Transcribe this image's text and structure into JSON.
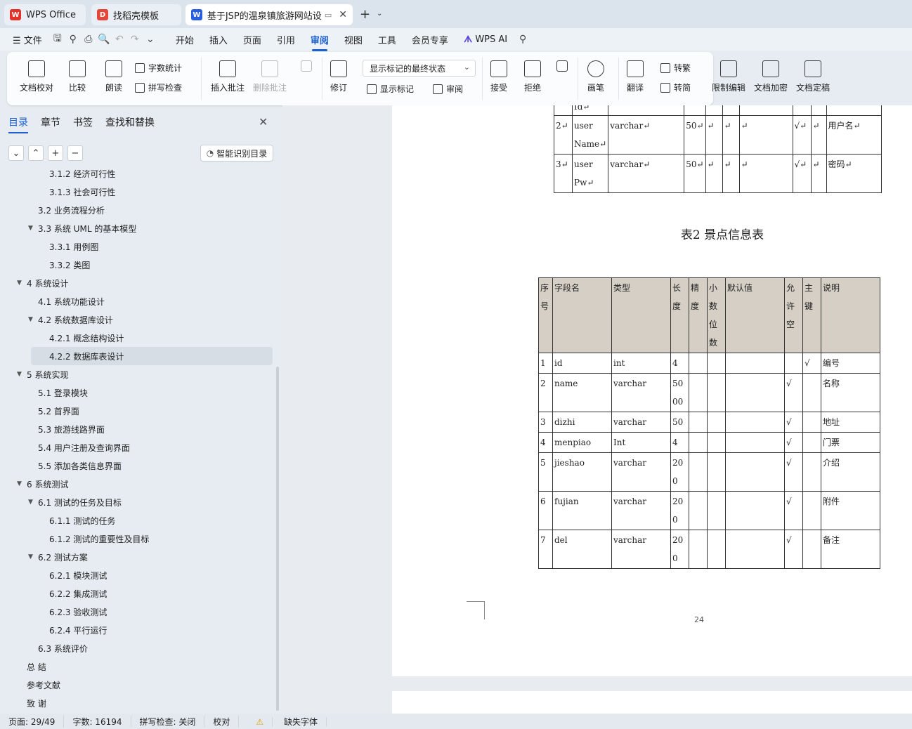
{
  "tabs": [
    {
      "label": "WPS Office"
    },
    {
      "label": "找稻壳模板"
    },
    {
      "label": "基于JSP的温泉镇旅游网站设计"
    }
  ],
  "menu": {
    "file": "文件",
    "items": [
      "开始",
      "插入",
      "页面",
      "引用",
      "审阅",
      "视图",
      "工具",
      "会员专享"
    ],
    "active": "审阅",
    "wps_ai": "WPS AI"
  },
  "ribbon": {
    "doc_check": "文档校对",
    "compare": "比较",
    "read": "朗读",
    "word_count": "字数统计",
    "spell_check": "拼写检查",
    "insert_comment": "插入批注",
    "delete_comment": "删除批注",
    "revise": "修订",
    "markup_dropdown": "显示标记的最终状态",
    "show_markup": "显示标记",
    "review": "审阅",
    "accept": "接受",
    "reject": "拒绝",
    "pen": "画笔",
    "translate": "翻译",
    "to_traditional": "转繁",
    "to_simplified": "转简",
    "restrict_edit": "限制编辑",
    "encrypt": "文档加密",
    "finalize": "文档定稿"
  },
  "sidebar": {
    "tabs": [
      "目录",
      "章节",
      "书签",
      "查找和替换"
    ],
    "smart_toc": "智能识别目录",
    "toc": [
      {
        "label": "3.1.2  经济可行性",
        "level": 3
      },
      {
        "label": "3.1.3  社会可行性",
        "level": 3
      },
      {
        "label": "3.2  业务流程分析",
        "level": 2
      },
      {
        "label": "3.3  系统 UML 的基本模型",
        "level": 2,
        "toggle": "▼"
      },
      {
        "label": "3.3.1  用例图",
        "level": 3
      },
      {
        "label": "3.3.2  类图",
        "level": 3
      },
      {
        "label": "4  系统设计",
        "level": 1,
        "toggle": "▼"
      },
      {
        "label": "4.1  系统功能设计",
        "level": 2
      },
      {
        "label": "4.2  系统数据库设计",
        "level": 2,
        "toggle": "▼"
      },
      {
        "label": "4.2.1  概念结构设计",
        "level": 3
      },
      {
        "label": "4.2.2  数据库表设计",
        "level": 3,
        "selected": true
      },
      {
        "label": "5  系统实现",
        "level": 1,
        "toggle": "▼"
      },
      {
        "label": "5.1 登录模块",
        "level": 2
      },
      {
        "label": "5.2  首界面",
        "level": 2
      },
      {
        "label": "5.3  旅游线路界面",
        "level": 2
      },
      {
        "label": "5.4  用户注册及查询界面",
        "level": 2
      },
      {
        "label": "5.5  添加各类信息界面",
        "level": 2
      },
      {
        "label": "6  系统测试",
        "level": 1,
        "toggle": "▼"
      },
      {
        "label": "6.1 测试的任务及目标",
        "level": 2,
        "toggle": "▼"
      },
      {
        "label": "6.1.1 测试的任务",
        "level": 3
      },
      {
        "label": "6.1.2 测试的重要性及目标",
        "level": 3
      },
      {
        "label": "6.2 测试方案",
        "level": 2,
        "toggle": "▼"
      },
      {
        "label": "6.2.1 模块测试",
        "level": 3
      },
      {
        "label": "6.2.2 集成测试",
        "level": 3
      },
      {
        "label": "6.2.3 验收测试",
        "level": 3
      },
      {
        "label": "6.2.4 平行运行",
        "level": 3
      },
      {
        "label": "6.3 系统评价",
        "level": 2
      },
      {
        "label": "总    结",
        "level": 1
      },
      {
        "label": "参考文献",
        "level": 1
      },
      {
        "label": "致    谢",
        "level": 1
      }
    ]
  },
  "document": {
    "table1_rows": [
      [
        "",
        "Id↵",
        "",
        "",
        "",
        "",
        "",
        "",
        "",
        ""
      ],
      [
        "2↵",
        "user Name↵",
        "varchar↵",
        "50↵",
        "↵",
        "↵",
        "↵",
        "√↵",
        "↵",
        "用户名↵"
      ],
      [
        "3↵",
        "user Pw↵",
        "varchar↵",
        "50↵",
        "↵",
        "↵",
        "↵",
        "√↵",
        "↵",
        "密码↵"
      ]
    ],
    "caption": "表2  景点信息表",
    "table2_header": [
      "序号",
      "字段名",
      "类型",
      "长度",
      "精度",
      "小数位数",
      "默认值",
      "允许空",
      "主键",
      "说明"
    ],
    "table2_rows": [
      [
        "1",
        "id",
        "int",
        "4",
        "",
        "",
        "",
        "",
        "√",
        "编号"
      ],
      [
        "2",
        "name",
        "varchar",
        "5000",
        "",
        "",
        "",
        "√",
        "",
        "名称"
      ],
      [
        "3",
        "dizhi",
        "varchar",
        "50",
        "",
        "",
        "",
        "√",
        "",
        "地址"
      ],
      [
        "4",
        "menpiao",
        "Int",
        "4",
        "",
        "",
        "",
        "√",
        "",
        "门票"
      ],
      [
        "5",
        "jieshao",
        "varchar",
        "200",
        "",
        "",
        "",
        "√",
        "",
        "介绍"
      ],
      [
        "6",
        "fujian",
        "varchar",
        "200",
        "",
        "",
        "",
        "√",
        "",
        "附件"
      ],
      [
        "7",
        "del",
        "varchar",
        "200",
        "",
        "",
        "",
        "√",
        "",
        "备注"
      ]
    ],
    "page_number": "24"
  },
  "status": {
    "page": "页面: 29/49",
    "words": "字数: 16194",
    "spell": "拼写检查: 关闭",
    "proof": "校对",
    "missing_font": "缺失字体"
  }
}
